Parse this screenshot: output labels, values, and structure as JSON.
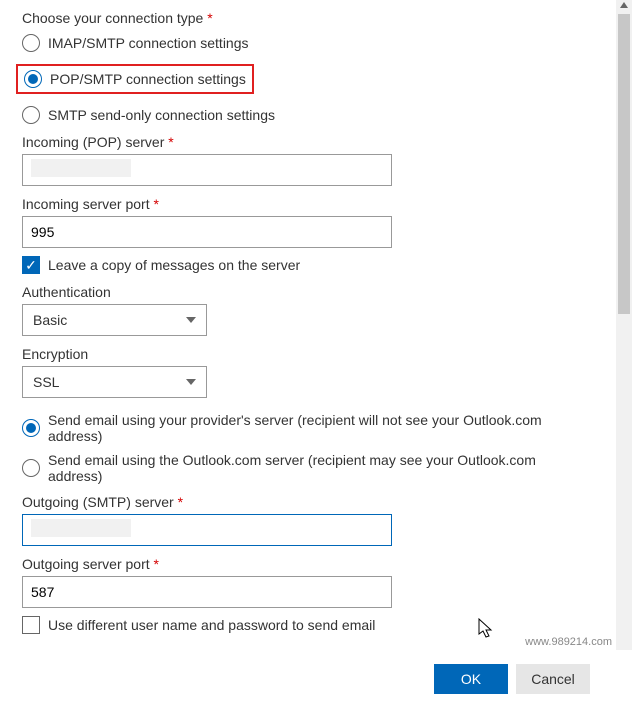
{
  "conn": {
    "label": "Choose your connection type",
    "req": "*",
    "imap": "IMAP/SMTP connection settings",
    "pop": "POP/SMTP connection settings",
    "smtp_only": "SMTP send-only connection settings"
  },
  "incoming": {
    "server_label": "Incoming (POP) server",
    "server_value": "",
    "port_label": "Incoming server port",
    "port_value": "995",
    "leave_copy": "Leave a copy of messages on the server"
  },
  "auth": {
    "label": "Authentication",
    "value": "Basic"
  },
  "enc": {
    "label": "Encryption",
    "value": "SSL"
  },
  "send": {
    "provider": "Send email using your provider's server (recipient will not see your Outlook.com address)",
    "outlook": "Send email using the Outlook.com server (recipient may see your Outlook.com address)"
  },
  "outgoing": {
    "server_label": "Outgoing (SMTP) server",
    "server_value": "",
    "port_label": "Outgoing server port",
    "port_value": "587",
    "diff_creds": "Use different user name and password to send email"
  },
  "buttons": {
    "ok": "OK",
    "cancel": "Cancel"
  },
  "watermark": "www.989214.com"
}
